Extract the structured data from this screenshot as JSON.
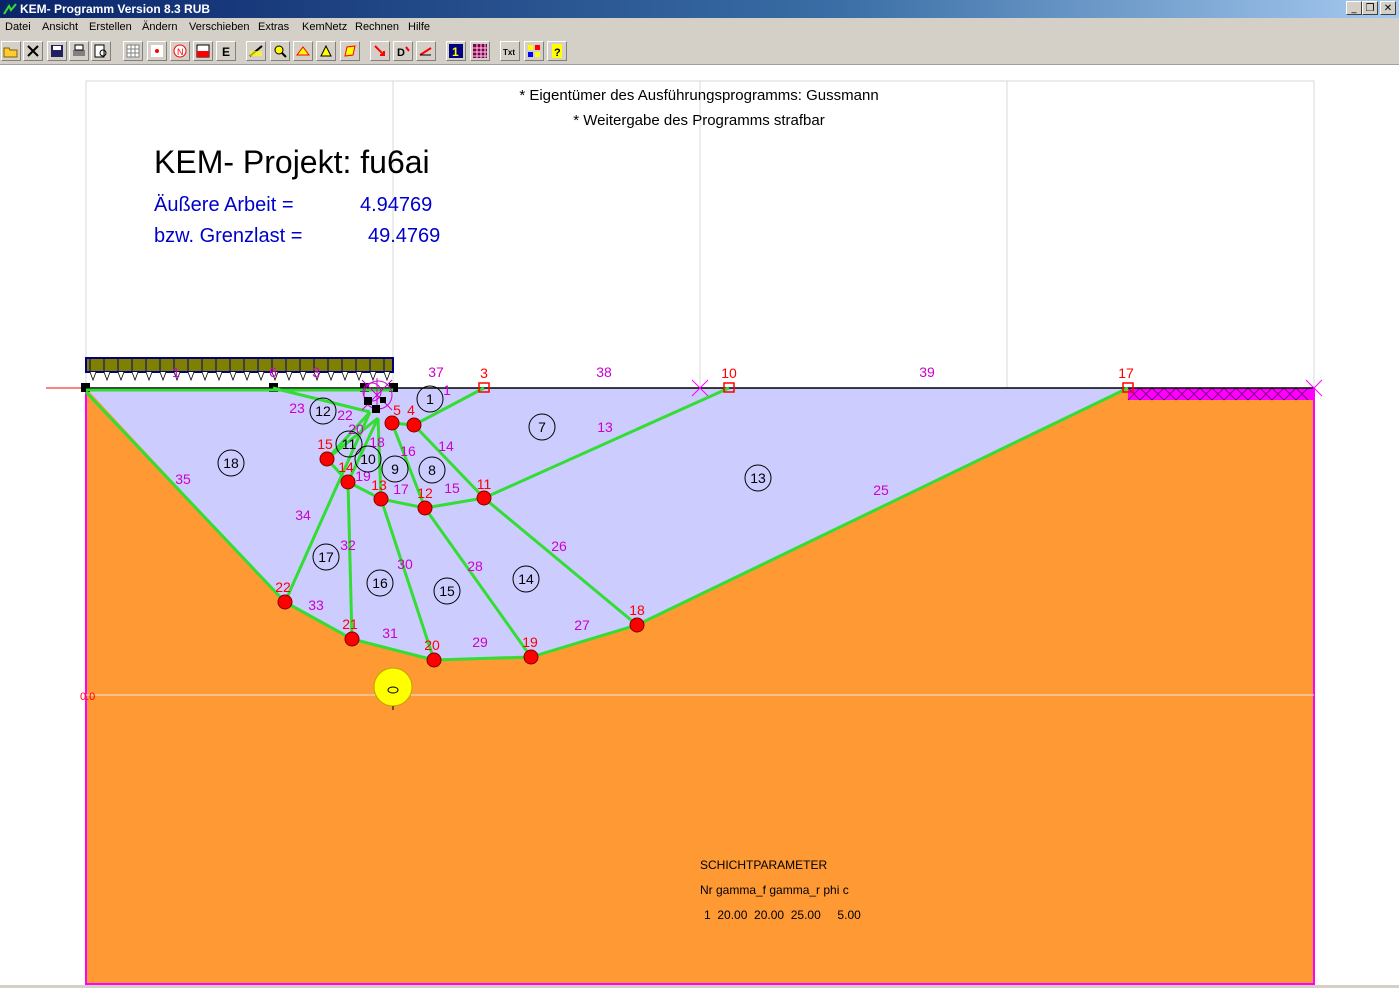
{
  "window": {
    "title": "KEM- Programm Version 8.3 RUB"
  },
  "menu": [
    "Datei",
    "Ansicht",
    "Erstellen",
    "Ändern",
    "Verschieben",
    "Extras",
    "KemNetz",
    "Rechnen",
    "Hilfe"
  ],
  "toolbar_icons": [
    "open-folder-icon",
    "close-icon",
    "save-icon",
    "print-icon",
    "print-preview-icon",
    "grid-icon",
    "point-icon",
    "node-n-icon",
    "layer-icon",
    "e-modulus-icon",
    "line-icon",
    "zoom-icon",
    "fill-icon",
    "triangle-icon",
    "polygon-icon",
    "arrow-load-icon",
    "d-load-icon",
    "vector-icon",
    "view-1-icon",
    "mesh-view-icon",
    "text-icon",
    "color-grid-icon",
    "help-icon"
  ],
  "drawing": {
    "notice_line1": "* Eigentümer des Ausführungsprogramms: Gussmann",
    "notice_line2": "* Weitergabe des Programms strafbar",
    "project_title": "KEM- Projekt: fu6ai",
    "work_label": "Äußere Arbeit =",
    "work_value": "4.94769",
    "limit_label": "bzw. Grenzlast =",
    "limit_value": "49.4769",
    "origin_label": "0.0",
    "params_title": "SCHICHTPARAMETER",
    "params_header": "Nr gamma_f gamma_r phi c",
    "params_row": "1  20.00  20.00  25.00     5.00",
    "colors": {
      "soil": "#ff9933",
      "mechanism": "#ccccff",
      "mesh": "#33dd33",
      "node": "#ff0000",
      "label": "#cc00cc",
      "result": "#0000cc",
      "surcharge": "#ff00ff"
    },
    "nodes": [
      {
        "id": "3",
        "value": 3,
        "kind": "surface"
      },
      {
        "id": "10",
        "value": 10,
        "kind": "surface"
      },
      {
        "id": "17",
        "value": 17,
        "kind": "surface"
      },
      {
        "id": "11",
        "value": 11,
        "kind": "inner"
      },
      {
        "id": "12",
        "value": 12,
        "kind": "inner"
      },
      {
        "id": "13",
        "value": 13,
        "kind": "inner"
      },
      {
        "id": "14",
        "value": 14,
        "kind": "inner"
      },
      {
        "id": "15",
        "value": 15,
        "kind": "inner"
      },
      {
        "id": "18",
        "value": 18,
        "kind": "inner"
      },
      {
        "id": "19",
        "value": 19,
        "kind": "inner"
      },
      {
        "id": "20",
        "value": 20,
        "kind": "inner"
      },
      {
        "id": "21",
        "value": 21,
        "kind": "inner"
      },
      {
        "id": "22",
        "value": 22,
        "kind": "inner"
      },
      {
        "id": "4",
        "value": 4,
        "kind": "inner"
      },
      {
        "id": "5",
        "value": 5,
        "kind": "inner"
      }
    ],
    "blocks": [
      "1",
      "7",
      "8",
      "9",
      "10",
      "11",
      "12",
      "13",
      "14",
      "15",
      "16",
      "17",
      "18"
    ],
    "edges": [
      "1",
      "13",
      "14",
      "15",
      "16",
      "17",
      "18",
      "19",
      "20",
      "22",
      "23",
      "25",
      "26",
      "27",
      "28",
      "29",
      "30",
      "31",
      "32",
      "33",
      "34",
      "35",
      "37",
      "38",
      "39"
    ]
  }
}
